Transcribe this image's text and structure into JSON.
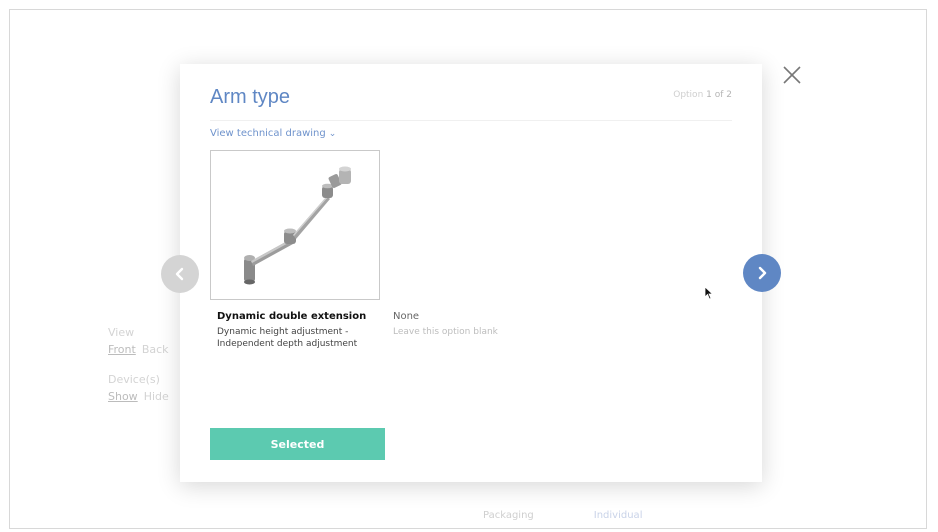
{
  "background": {
    "view_label": "View",
    "view_options": [
      "Front",
      "Back"
    ],
    "device_label": "Device(s)",
    "device_options": [
      "Show",
      "Hide"
    ],
    "packaging_label": "Packaging",
    "packaging_value": "Individual"
  },
  "modal": {
    "title": "Arm type",
    "option_counter_prefix": "Option ",
    "option_counter_current": "1 of 2",
    "tech_drawing_link": "View technical drawing",
    "options": [
      {
        "name": "Dynamic double extension",
        "description_line1": "Dynamic height adjustment -",
        "description_line2": "Independent depth adjustment",
        "image": "monitor-arm-illustration"
      },
      {
        "name": "None",
        "description_line1": "Leave this option blank",
        "description_line2": ""
      }
    ],
    "selected_button_label": "Selected"
  },
  "icons": {
    "close": "close-icon",
    "prev": "chevron-left-icon",
    "next": "chevron-right-icon",
    "tech_link_chevron": "chevron-down-icon"
  },
  "colors": {
    "title": "#5f87c4",
    "selected_button": "#5ccab0",
    "next_button": "#5f87c4",
    "prev_button": "#d4d4d4"
  }
}
